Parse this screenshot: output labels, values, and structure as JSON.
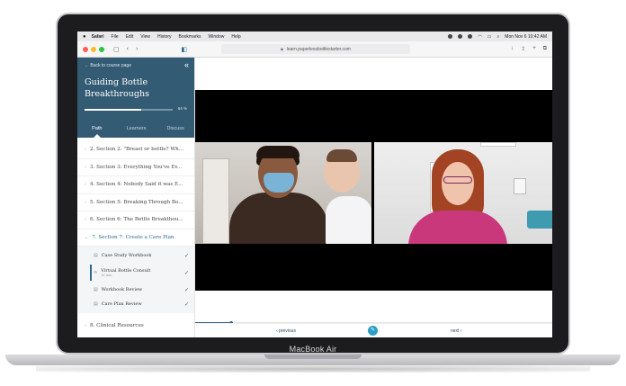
{
  "device": {
    "brand_label": "MacBook Air"
  },
  "menubar": {
    "items": [
      "Safari",
      "File",
      "Edit",
      "View",
      "History",
      "Bookmarks",
      "Window",
      "Help"
    ],
    "clock": "Mon Nov 6 10:42 AM"
  },
  "browser": {
    "url": "learn.paperlessbottlestarter.com"
  },
  "sidebar": {
    "back_label": "← Back to course page",
    "collapse_icon": "«",
    "course_title": "Guiding Bottle Breakthroughs",
    "progress_percent": 64,
    "progress_label": "64 %",
    "tabs": [
      {
        "label": "Path",
        "active": true
      },
      {
        "label": "Learners",
        "active": false
      },
      {
        "label": "Discuss",
        "active": false
      }
    ],
    "sections_before": [
      {
        "label": "2. Section 2: \"Breast or bottle? Wh..."
      },
      {
        "label": "3. Section 3: Everything You've Ev..."
      },
      {
        "label": "4. Section 4: Nobody Said it was E..."
      },
      {
        "label": "5. Section 5: Breaking Through Bo..."
      },
      {
        "label": "6. Section 6: The Bottle Breakthou..."
      }
    ],
    "active_section": {
      "label": "7. Section 7: Create a Care Plan"
    },
    "subitems": [
      {
        "label": "Case Study Workbook",
        "duration": "",
        "icon": "doc-icon",
        "check": "✓"
      },
      {
        "label": "Virtual Bottle Consult",
        "duration": "28 min",
        "icon": "play-icon",
        "check": "✓"
      },
      {
        "label": "Workbook Review",
        "duration": "",
        "icon": "doc-icon",
        "check": "✓"
      },
      {
        "label": "Care Plan Review",
        "duration": "",
        "icon": "doc-icon",
        "check": "✓"
      }
    ],
    "sections_after": [
      {
        "label": "8. Clinical Resources"
      }
    ]
  },
  "player": {
    "progress_fraction": 0.1
  },
  "footer_nav": {
    "previous_label": "‹ previous",
    "next_label": "next ›"
  },
  "colors": {
    "sidebar_header": "#345b74",
    "accent": "#2d6b8e",
    "fab": "#2a9ec4"
  }
}
